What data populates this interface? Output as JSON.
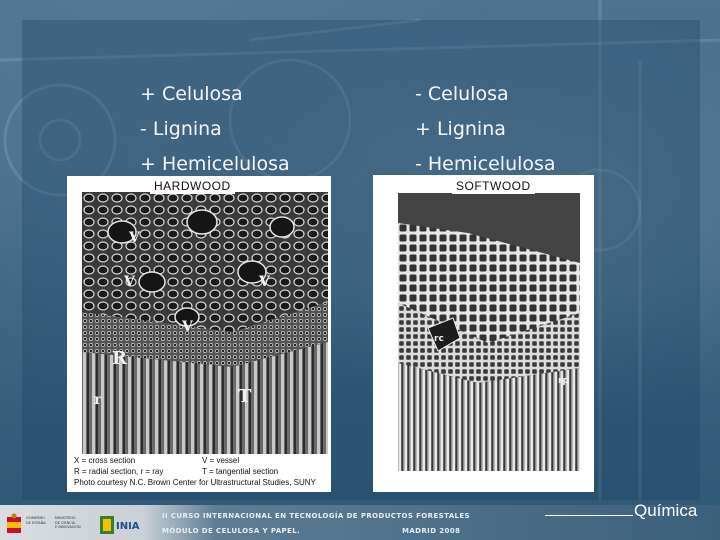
{
  "left_column": {
    "lines": [
      "+ Celulosa",
      "- Lignina",
      "+ Hemicelulosa"
    ]
  },
  "right_column": {
    "lines": [
      "- Celulosa",
      "+ Lignina",
      "- Hemicelulosa"
    ]
  },
  "hardwood": {
    "label": "HARDWOOD",
    "markers": [
      "V",
      "V",
      "V",
      "V",
      "R",
      "r",
      "T"
    ],
    "caption": {
      "row1_a": "X = cross section",
      "row1_b": "V = vessel",
      "row2_a": "R = radial section, r = ray",
      "row2_b": "T = tangential section",
      "row3": "Photo courtesy N.C. Brown Center for Ultrastructural Studies, SUNY"
    }
  },
  "softwood": {
    "label": "SOFTWOOD",
    "markers": [
      "rc",
      "rp"
    ]
  },
  "footer": {
    "line1": "II CURSO INTERNACIONAL EN TECNOLOGÍA DE PRODUCTOS FORESTALES",
    "line2": "MÓDULO DE CELULOSA Y PAPEL.",
    "date": "MADRID 2008",
    "gobierno": [
      "GOBIERNO",
      "DE ESPAÑA"
    ],
    "ministerio": [
      "MINISTERIO",
      "DE CIENCIA",
      "E INNOVACIÓN"
    ],
    "inia": "INIA"
  },
  "corner_label": "Química",
  "colors": {
    "background": "#3d6684",
    "text": "#f4f6f8",
    "footer_text": "#e8eef3"
  }
}
